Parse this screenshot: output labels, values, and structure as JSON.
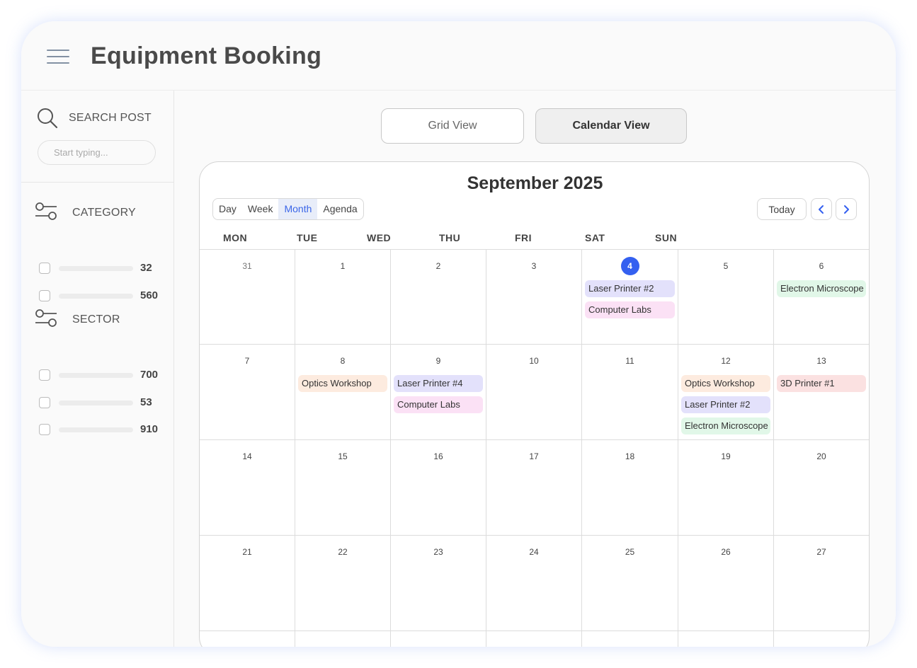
{
  "header": {
    "title": "Equipment Booking",
    "menu_icon": "hamburger-menu-icon"
  },
  "sidebar": {
    "search_label": "SEARCH POST",
    "search_placeholder": "Start typing...",
    "category": {
      "label": "CATEGORY",
      "counts": [
        "32",
        "560"
      ]
    },
    "sector": {
      "label": "SECTOR",
      "counts": [
        "700",
        "53",
        "910"
      ]
    }
  },
  "views": {
    "grid_label": "Grid View",
    "calendar_label": "Calendar View",
    "active": "Calendar View"
  },
  "calendar": {
    "title": "September 2025",
    "modes": [
      "Day",
      "Week",
      "Month",
      "Agenda"
    ],
    "active_mode": "Month",
    "today_label": "Today",
    "weekdays": [
      "MON",
      "TUE",
      "WED",
      "THU",
      "FRI",
      "SAT",
      "SUN"
    ],
    "today_date": "4",
    "weeks": [
      [
        {
          "day": "31",
          "events": []
        },
        {
          "day": "1",
          "events": []
        },
        {
          "day": "2",
          "events": []
        },
        {
          "day": "3",
          "events": []
        },
        {
          "day": "4",
          "today": true,
          "events": [
            {
              "label": "Laser Printer #2",
              "color": "#e3e1fb"
            },
            {
              "label": "Computer Labs",
              "color": "#fbe1f5"
            }
          ]
        },
        {
          "day": "5",
          "events": []
        },
        {
          "day": "6",
          "events": [
            {
              "label": "Electron Microscope",
              "color": "#e1f7e8"
            }
          ]
        }
      ],
      [
        {
          "day": "7",
          "events": []
        },
        {
          "day": "8",
          "events": [
            {
              "label": "Optics Workshop",
              "color": "#fdebdf"
            }
          ]
        },
        {
          "day": "9",
          "events": [
            {
              "label": "Laser Printer #4",
              "color": "#e3e1fb"
            },
            {
              "label": "Computer Labs",
              "color": "#fbe1f5"
            }
          ]
        },
        {
          "day": "10",
          "events": []
        },
        {
          "day": "11",
          "events": []
        },
        {
          "day": "12",
          "events": [
            {
              "label": "Optics Workshop",
              "color": "#fdebdf"
            },
            {
              "label": "Laser Printer #2",
              "color": "#e3e1fb"
            },
            {
              "label": "Electron Microscope",
              "color": "#e1f7e8"
            }
          ]
        },
        {
          "day": "13",
          "events": [
            {
              "label": "3D Printer #1",
              "color": "#fbe1e1"
            }
          ]
        }
      ],
      [
        {
          "day": "14",
          "events": []
        },
        {
          "day": "15",
          "events": []
        },
        {
          "day": "16",
          "events": []
        },
        {
          "day": "17",
          "events": []
        },
        {
          "day": "18",
          "events": []
        },
        {
          "day": "19",
          "events": []
        },
        {
          "day": "20",
          "events": []
        }
      ],
      [
        {
          "day": "21",
          "events": []
        },
        {
          "day": "22",
          "events": []
        },
        {
          "day": "23",
          "events": []
        },
        {
          "day": "24",
          "events": []
        },
        {
          "day": "25",
          "events": []
        },
        {
          "day": "26",
          "events": []
        },
        {
          "day": "27",
          "events": []
        }
      ]
    ]
  },
  "colors": {
    "accent": "#3460f0",
    "active_mode_bg": "#e8edf9"
  }
}
